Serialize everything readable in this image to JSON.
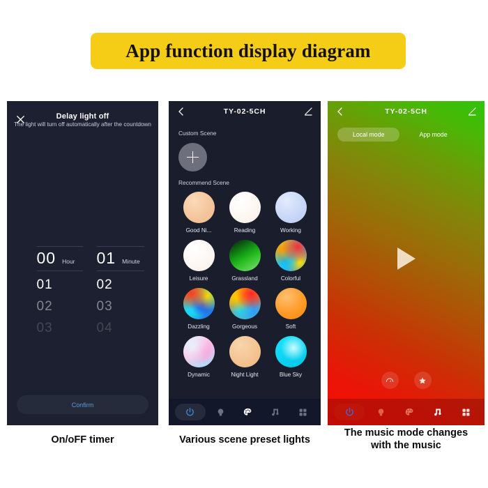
{
  "banner": {
    "title": "App function display diagram",
    "bg_color": "#f5cc16"
  },
  "panel1": {
    "title": "Delay light off",
    "subtitle": "The light will turn off automatically after the countdown",
    "close_icon": "close-icon",
    "picker": {
      "hour": {
        "selected": "00",
        "unit": "Hour",
        "next": [
          "01",
          "02",
          "03"
        ]
      },
      "minute": {
        "selected": "01",
        "unit": "Minute",
        "next": [
          "02",
          "03",
          "04"
        ]
      }
    },
    "confirm_label": "Confirm",
    "confirm_color": "#5b9ddb",
    "caption": "On/oFF timer"
  },
  "panel2": {
    "header": {
      "title": "TY-02-5CH",
      "back_icon": "chevron-left-icon",
      "edit_icon": "pencil-icon"
    },
    "custom_scene_label": "Custom Scene",
    "add_button": "plus-icon",
    "recommend_scene_label": "Recommend Scene",
    "scenes": [
      {
        "name": "Good Ni...",
        "swatch": "sc-good"
      },
      {
        "name": "Reading",
        "swatch": "sc-reading"
      },
      {
        "name": "Working",
        "swatch": "sc-working"
      },
      {
        "name": "Leisure",
        "swatch": "sc-leisure"
      },
      {
        "name": "Grassland",
        "swatch": "sc-grass"
      },
      {
        "name": "Colorful",
        "swatch": "sc-colorful"
      },
      {
        "name": "Dazzling",
        "swatch": "sc-dazzling"
      },
      {
        "name": "Gorgeous",
        "swatch": "sc-gorgeous"
      },
      {
        "name": "Soft",
        "swatch": "sc-soft"
      },
      {
        "name": "Dynamic",
        "swatch": "sc-dynamic"
      },
      {
        "name": "Night Light",
        "swatch": "sc-night"
      },
      {
        "name": "Blue Sky",
        "swatch": "sc-bluesky"
      }
    ],
    "nav": [
      "power-icon",
      "bulb-icon",
      "palette-icon",
      "music-note-icon",
      "grid-icon"
    ],
    "nav_active": "power-icon",
    "caption": "Various scene preset lights"
  },
  "panel3": {
    "header": {
      "title": "TY-02-5CH",
      "back_icon": "chevron-left-icon",
      "edit_icon": "pencil-icon"
    },
    "modes": [
      {
        "label": "Local mode",
        "selected": true
      },
      {
        "label": "App mode",
        "selected": false
      }
    ],
    "play_icon": "play-icon",
    "round_controls": [
      "speedometer-icon",
      "star-icon"
    ],
    "nav": [
      "power-icon",
      "bulb-icon",
      "palette-icon",
      "music-note-icon",
      "grid-icon"
    ],
    "nav_active": "music-note-icon",
    "caption_line1": "The music mode changes",
    "caption_line2": "with the music"
  }
}
